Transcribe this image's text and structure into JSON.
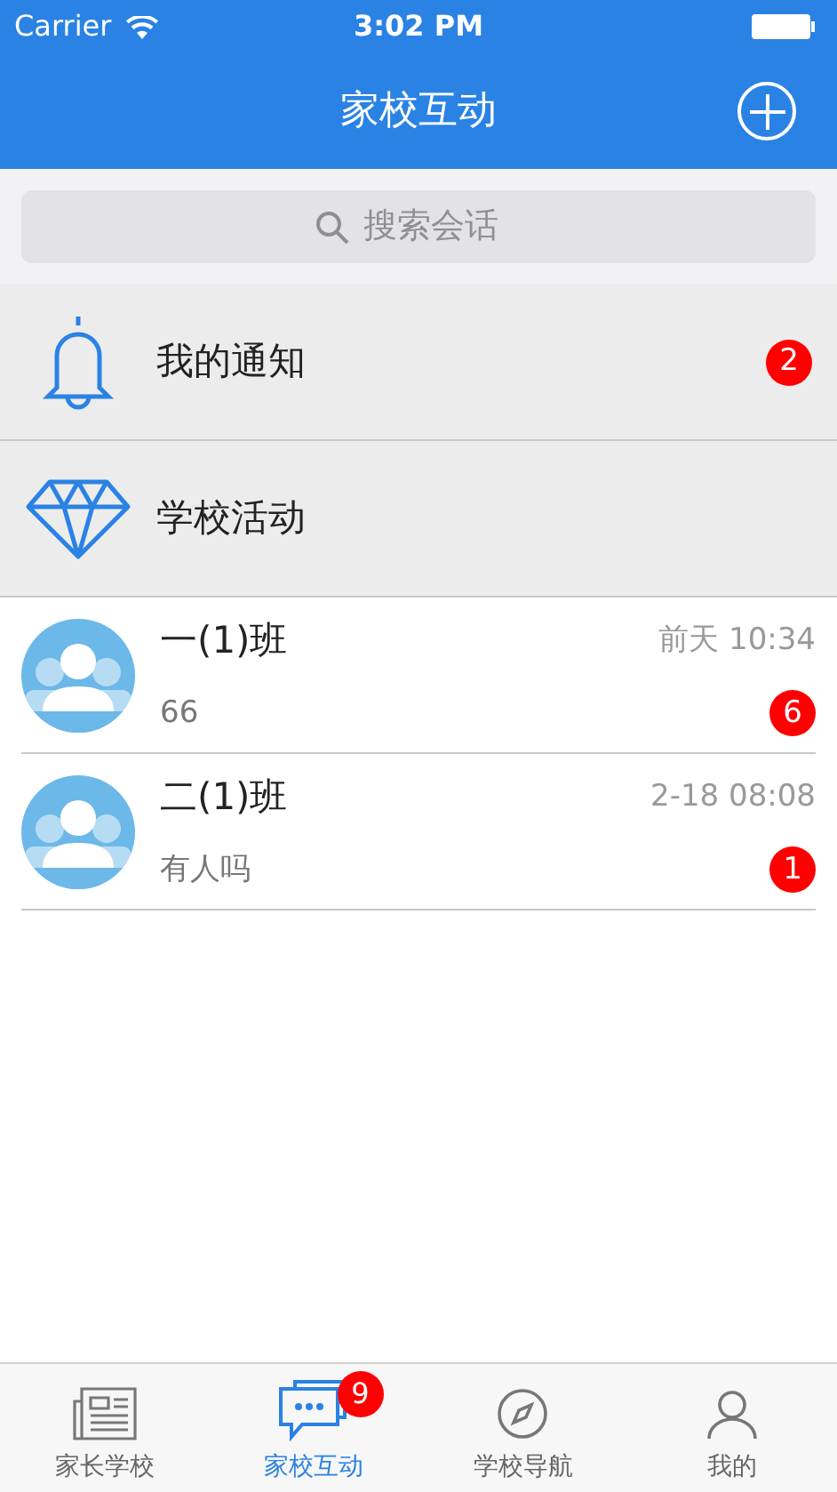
{
  "status_bar": {
    "carrier": "Carrier",
    "time": "3:02 PM"
  },
  "nav": {
    "title": "家校互动"
  },
  "search": {
    "placeholder": "搜索会话"
  },
  "shortcuts": [
    {
      "kind": "bell",
      "label": "我的通知",
      "badge": "2"
    },
    {
      "kind": "diamond",
      "label": "学校活动"
    }
  ],
  "conversations": [
    {
      "name": "一(1)班",
      "time": "前天 10:34",
      "preview": "66",
      "badge": "6"
    },
    {
      "name": "二(1)班",
      "time": "2-18 08:08",
      "preview": "有人吗",
      "badge": "1"
    }
  ],
  "tab_bar": [
    {
      "kind": "news",
      "label": "家长学校",
      "selected": false
    },
    {
      "kind": "chat",
      "label": "家校互动",
      "selected": true,
      "badge": "9"
    },
    {
      "kind": "compass",
      "label": "学校导航",
      "selected": false
    },
    {
      "kind": "person",
      "label": "我的",
      "selected": false
    }
  ]
}
